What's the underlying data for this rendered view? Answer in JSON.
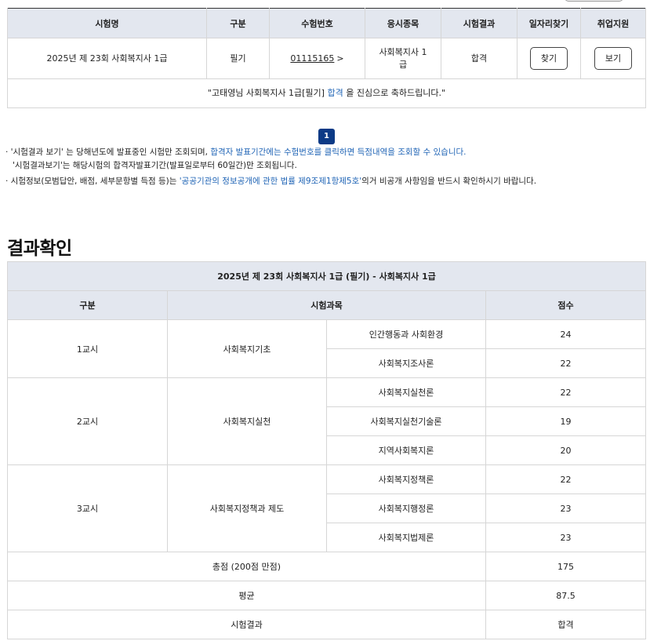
{
  "top_table": {
    "headers": [
      "시험명",
      "구분",
      "수험번호",
      "응시종목",
      "시험결과",
      "일자리찾기",
      "취업지원"
    ],
    "row": {
      "exam_name": "2025년 제 23회 사회복지사 1급",
      "category": "필기",
      "reg_number": "01115165",
      "reg_chevron": ">",
      "subject": "사회복지사 1급",
      "result": "합격",
      "job_button": "찾기",
      "support_button": "보기"
    },
    "message_pre": "\"고태영님 사회복지사 1급[필기] ",
    "message_pass": "합격",
    "message_post": " 을 진심으로 축하드립니다.\""
  },
  "pagination": {
    "current": "1"
  },
  "notes": {
    "n1_black": "· '시험결과 보기' 는 당해년도에 발표중인 시험만 조회되며, ",
    "n1_blue": "합격자 발표기간에는 수험번호를 클릭하면 득점내역을 조회할 수 있습니다.",
    "n2": "'시험결과보기'는 해당시험의 합격자발표기간(발표일로부터 60일간)만 조회됩니다.",
    "n3_pre": "· 시험정보(모범답안, 배점, 세부문항별 득점 등)는 ",
    "n3_blue": "'공공기관의 정보공개에 관한 법률 제9조제1항제5호'",
    "n3_post": "의거 비공개 사항임을 반드시 확인하시기 바랍니다."
  },
  "result_section": {
    "title": "결과확인",
    "caption": "2025년 제 23회 사회복지사 1급 (필기) - 사회복지사 1급",
    "headers": {
      "category": "구분",
      "subject": "시험과목",
      "score": "점수"
    },
    "groups": [
      {
        "period": "1교시",
        "area": "사회복지기초",
        "rows": [
          {
            "subject": "인간행동과 사회환경",
            "score": "24"
          },
          {
            "subject": "사회복지조사론",
            "score": "22"
          }
        ]
      },
      {
        "period": "2교시",
        "area": "사회복지실천",
        "rows": [
          {
            "subject": "사회복지실천론",
            "score": "22"
          },
          {
            "subject": "사회복지실천기술론",
            "score": "19"
          },
          {
            "subject": "지역사회복지론",
            "score": "20"
          }
        ]
      },
      {
        "period": "3교시",
        "area": "사회복지정책과 제도",
        "rows": [
          {
            "subject": "사회복지정책론",
            "score": "22"
          },
          {
            "subject": "사회복지행정론",
            "score": "23"
          },
          {
            "subject": "사회복지법제론",
            "score": "23"
          }
        ]
      }
    ],
    "total_label": "총점 (200점 만점)",
    "total": "175",
    "avg_label": "평균",
    "avg": "87.5",
    "final_label": "시험결과",
    "final": "합격"
  },
  "colors": {
    "accent_blue": "#1e63b5",
    "page_badge": "#0c3a86",
    "header_bg": "#e3e7ef"
  }
}
